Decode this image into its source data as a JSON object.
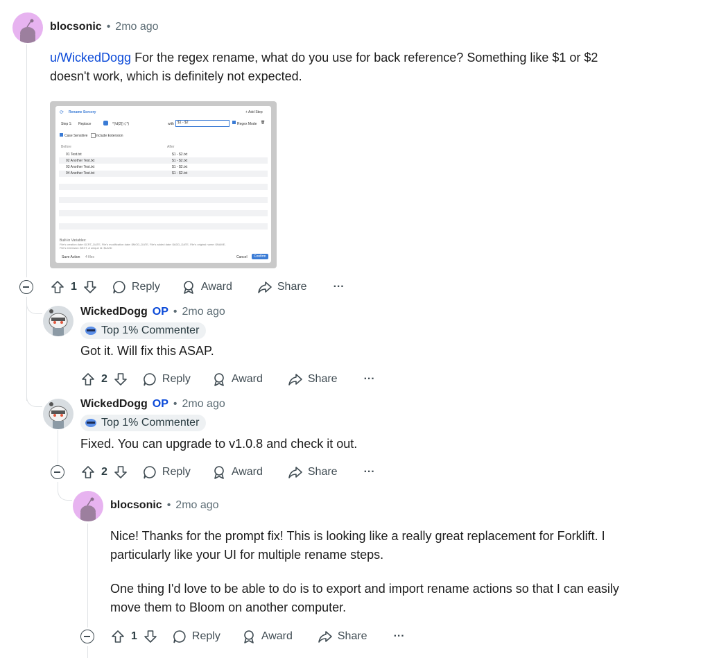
{
  "comments": [
    {
      "author": "blocsonic",
      "time": "2mo ago",
      "mention": "u/WickedDogg",
      "text_lines": [
        " For the regex rename, what do you use for back reference? Something like $1 or $2",
        "doesn't work, which is definitely not expected."
      ],
      "votes": "1"
    },
    {
      "author": "WickedDogg",
      "op": "OP",
      "time": "2mo ago",
      "badge": "Top 1% Commenter",
      "text": "Got it. Will fix this ASAP.",
      "votes": "2"
    },
    {
      "author": "WickedDogg",
      "op": "OP",
      "time": "2mo ago",
      "badge": "Top 1% Commenter",
      "text": "Fixed. You can upgrade to v1.0.8 and check it out.",
      "votes": "2"
    },
    {
      "author": "blocsonic",
      "time": "2mo ago",
      "paragraphs": [
        [
          "Nice! Thanks for the prompt fix! This is looking like a really great replacement for Forklift. I",
          "particularly like your UI for multiple rename steps."
        ],
        [
          "One thing I'd love to be able to do is to export and import rename actions so that I can easily",
          "move them to Bloom on another computer."
        ]
      ],
      "votes": "1"
    }
  ],
  "actions": {
    "reply": "Reply",
    "award": "Award",
    "share": "Share",
    "more": "···"
  },
  "separator": "•",
  "screenshot": {
    "title": "Rename Sorcery",
    "add_step": "+ Add Step",
    "step_label": "Step 1:",
    "mode": "Replace",
    "find": "^(\\d{2}) (.*)",
    "with_label": "with",
    "replace": "$1 - $2",
    "regex_mode": "Regex Mode",
    "case_sensitive": "Case Sensitive",
    "include_ext": "Include Extension",
    "col_before": "Before",
    "col_after": "After",
    "before": [
      "01 Test.txt",
      "02 Another Test.txt",
      "03 Another Test.txt",
      "04 Another Test.txt"
    ],
    "after": [
      "$1 - $2.txt",
      "$1 - $2.txt",
      "$1 - $2.txt",
      "$1 - $2.txt"
    ],
    "vars_title": "Built-in Variables:",
    "vars_line1": "File's creation date: $CRT_DATE, File's modification date: $MOD_DATE, File's added date: $ADD_DATE, File's original name: $NAME,",
    "vars_line2": "File's extension: $EXT, A unique Id: $UUID",
    "save_action": "Save Action",
    "files_count": "4 files",
    "cancel": "Cancel",
    "confirm": "Confirm"
  },
  "colors": {
    "op": "#0a49d8",
    "meta": "#5c6c74",
    "badge_bg": "#eef1f3",
    "thread": "#dfe2e5"
  }
}
